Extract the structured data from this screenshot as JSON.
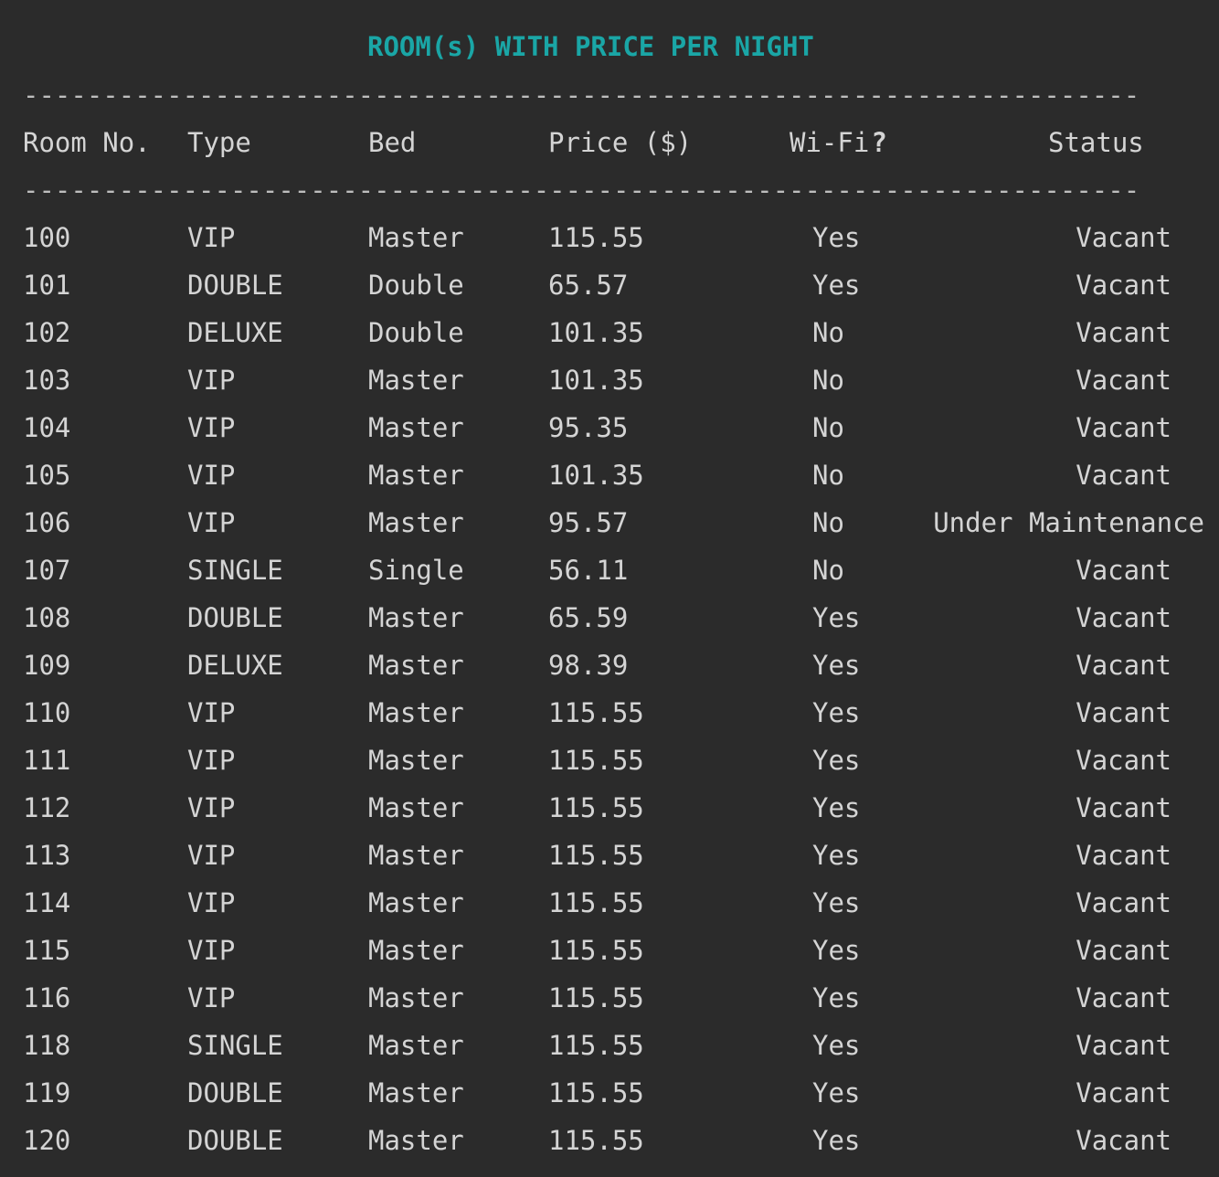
{
  "title": "ROOM(s) WITH PRICE PER NIGHT",
  "divider": "----------------------------------------------------------------------",
  "headers": {
    "room": "Room No.",
    "type": "Type",
    "bed": "Bed",
    "price": "Price ($)",
    "wifi": "Wi-Fi",
    "wifi_q": "?",
    "status": "Status"
  },
  "rows": [
    {
      "room": "100",
      "type": "VIP",
      "bed": "Master",
      "price": "115.55",
      "wifi": "Yes",
      "status": "Vacant"
    },
    {
      "room": "101",
      "type": "DOUBLE",
      "bed": "Double",
      "price": "65.57",
      "wifi": "Yes",
      "status": "Vacant"
    },
    {
      "room": "102",
      "type": "DELUXE",
      "bed": "Double",
      "price": "101.35",
      "wifi": "No",
      "status": "Vacant"
    },
    {
      "room": "103",
      "type": "VIP",
      "bed": "Master",
      "price": "101.35",
      "wifi": "No",
      "status": "Vacant"
    },
    {
      "room": "104",
      "type": "VIP",
      "bed": "Master",
      "price": "95.35",
      "wifi": "No",
      "status": "Vacant"
    },
    {
      "room": "105",
      "type": "VIP",
      "bed": "Master",
      "price": "101.35",
      "wifi": "No",
      "status": "Vacant"
    },
    {
      "room": "106",
      "type": "VIP",
      "bed": "Master",
      "price": "95.57",
      "wifi": "No",
      "status": "Under Maintenance"
    },
    {
      "room": "107",
      "type": "SINGLE",
      "bed": "Single",
      "price": "56.11",
      "wifi": "No",
      "status": "Vacant"
    },
    {
      "room": "108",
      "type": "DOUBLE",
      "bed": "Master",
      "price": "65.59",
      "wifi": "Yes",
      "status": "Vacant"
    },
    {
      "room": "109",
      "type": "DELUXE",
      "bed": "Master",
      "price": "98.39",
      "wifi": "Yes",
      "status": "Vacant"
    },
    {
      "room": "110",
      "type": "VIP",
      "bed": "Master",
      "price": "115.55",
      "wifi": "Yes",
      "status": "Vacant"
    },
    {
      "room": "111",
      "type": "VIP",
      "bed": "Master",
      "price": "115.55",
      "wifi": "Yes",
      "status": "Vacant"
    },
    {
      "room": "112",
      "type": "VIP",
      "bed": "Master",
      "price": "115.55",
      "wifi": "Yes",
      "status": "Vacant"
    },
    {
      "room": "113",
      "type": "VIP",
      "bed": "Master",
      "price": "115.55",
      "wifi": "Yes",
      "status": "Vacant"
    },
    {
      "room": "114",
      "type": "VIP",
      "bed": "Master",
      "price": "115.55",
      "wifi": "Yes",
      "status": "Vacant"
    },
    {
      "room": "115",
      "type": "VIP",
      "bed": "Master",
      "price": "115.55",
      "wifi": "Yes",
      "status": "Vacant"
    },
    {
      "room": "116",
      "type": "VIP",
      "bed": "Master",
      "price": "115.55",
      "wifi": "Yes",
      "status": "Vacant"
    },
    {
      "room": "118",
      "type": "SINGLE",
      "bed": "Master",
      "price": "115.55",
      "wifi": "Yes",
      "status": "Vacant"
    },
    {
      "room": "119",
      "type": "DOUBLE",
      "bed": "Master",
      "price": "115.55",
      "wifi": "Yes",
      "status": "Vacant"
    },
    {
      "room": "120",
      "type": "DOUBLE",
      "bed": "Master",
      "price": "115.55",
      "wifi": "Yes",
      "status": "Vacant"
    }
  ]
}
